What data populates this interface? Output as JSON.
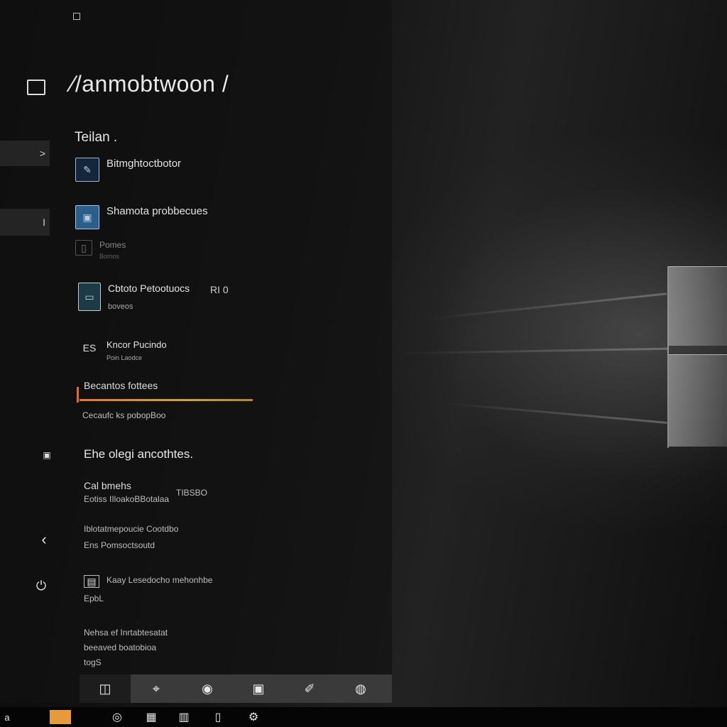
{
  "window": {
    "title": "⁄/anmobtwoon /",
    "section_heading": "Teilan ."
  },
  "rail": {
    "btn1_label": ">",
    "btn2_label": "I",
    "back_icon": "chevron-left-icon",
    "power_icon": "power-icon"
  },
  "items": [
    {
      "title": "Bitmghtoctbotor",
      "icon": "pen-icon"
    },
    {
      "title": "Shamota probbecues",
      "icon": "app-icon"
    },
    {
      "title": "Pomes",
      "sub": "Bomos",
      "icon": "document-icon"
    },
    {
      "title": "Cbtoto Petootuocs",
      "sub": "boveos",
      "value": "RI 0",
      "icon": "display-icon"
    },
    {
      "title": "Kncor Pucindo",
      "sub": "Poin Laodce",
      "badge": "ES",
      "icon": "text-icon"
    }
  ],
  "highlight": {
    "title": "Becantos fottees",
    "sub": "Cecaufc ks pobopBoo"
  },
  "group2": {
    "heading": "Ehe olegi ancothtes.",
    "row1_title": "Cal bmehs",
    "row1_sub": "Eotiss IIloakoBBotalaa",
    "row1_value": "TIBSBO",
    "row2_title": "Iblotatmepoucie Cootdbo",
    "row2_sub": "Ens Pomsoctsoutd",
    "row3_title": "Kaay Lesedocho mehonhbe",
    "row3_sub": "EpbL",
    "row4_title": "Nehsa ef Inrtabtesatat",
    "row4_sub": "beeaved boatobioa",
    "row4_extra": "togS"
  },
  "dock": {
    "buttons": [
      "app-tile-icon",
      "pin-icon",
      "camera-icon",
      "monitor-icon",
      "pen-tool-icon",
      "globe-icon"
    ]
  },
  "taskbar": {
    "left_label": "a",
    "icons": [
      "chrome-icon",
      "grid-icon",
      "store-icon",
      "tablet-icon",
      "settings-icon"
    ]
  },
  "colors": {
    "accent_orange": "#e4782a",
    "start_button": "#e59a3c",
    "app_blue": "#2c5e8a"
  }
}
